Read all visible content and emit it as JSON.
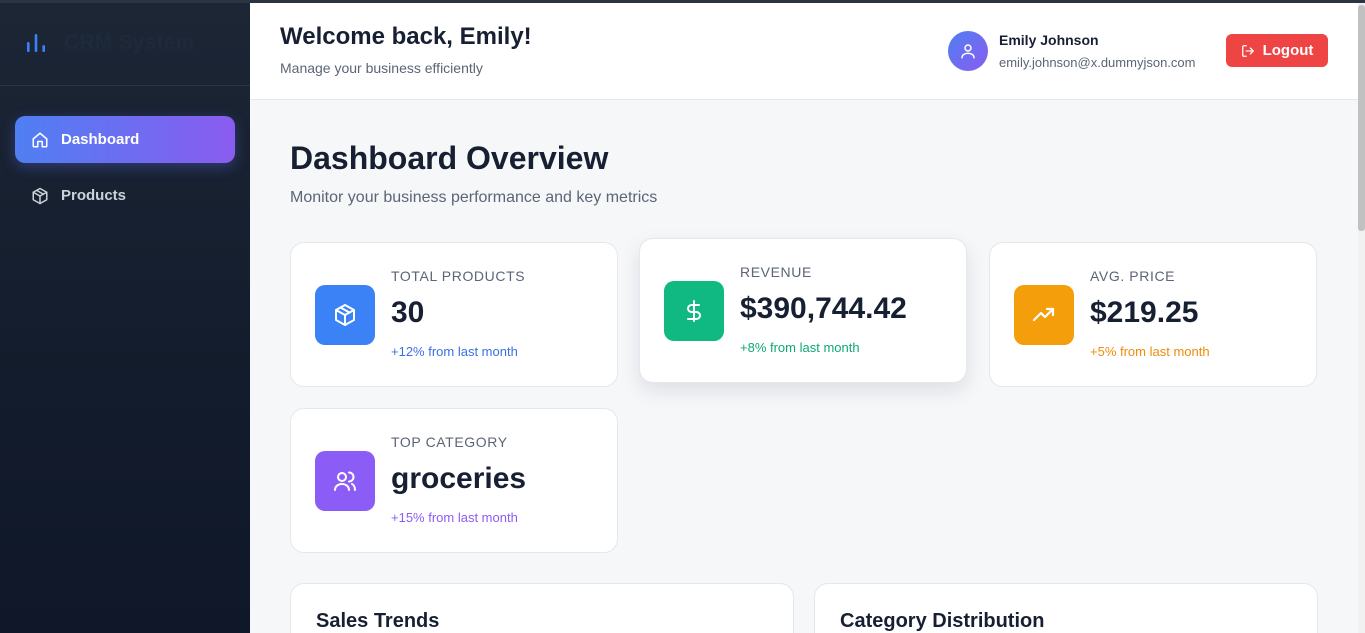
{
  "brand": {
    "name": "CRM System"
  },
  "sidebar": {
    "items": [
      {
        "label": "Dashboard",
        "icon": "home-icon",
        "active": true
      },
      {
        "label": "Products",
        "icon": "box-icon",
        "active": false
      }
    ]
  },
  "header": {
    "title": "Welcome back, Emily!",
    "subtitle": "Manage your business efficiently",
    "user": {
      "name": "Emily Johnson",
      "email": "emily.johnson@x.dummyjson.com"
    },
    "logout_label": "Logout"
  },
  "main": {
    "title": "Dashboard Overview",
    "subtitle": "Monitor your business performance and key metrics",
    "stats": [
      {
        "label": "TOTAL PRODUCTS",
        "value": "30",
        "change": "+12% from last month",
        "color": "#3b82f6",
        "change_color": "#3b6fe0",
        "icon": "box-icon"
      },
      {
        "label": "REVENUE",
        "value": "$390,744.42",
        "change": "+8% from last month",
        "color": "#10b981",
        "change_color": "#10a874",
        "icon": "dollar-icon"
      },
      {
        "label": "AVG. PRICE",
        "value": "$219.25",
        "change": "+5% from last month",
        "color": "#f59e0b",
        "change_color": "#f08c0b",
        "icon": "trending-up-icon"
      },
      {
        "label": "TOP CATEGORY",
        "value": "groceries",
        "change": "+15% from last month",
        "color": "#8b5cf6",
        "change_color": "#8b5cf6",
        "icon": "users-icon"
      }
    ],
    "panels": [
      {
        "title": "Sales Trends"
      },
      {
        "title": "Category Distribution"
      }
    ]
  }
}
